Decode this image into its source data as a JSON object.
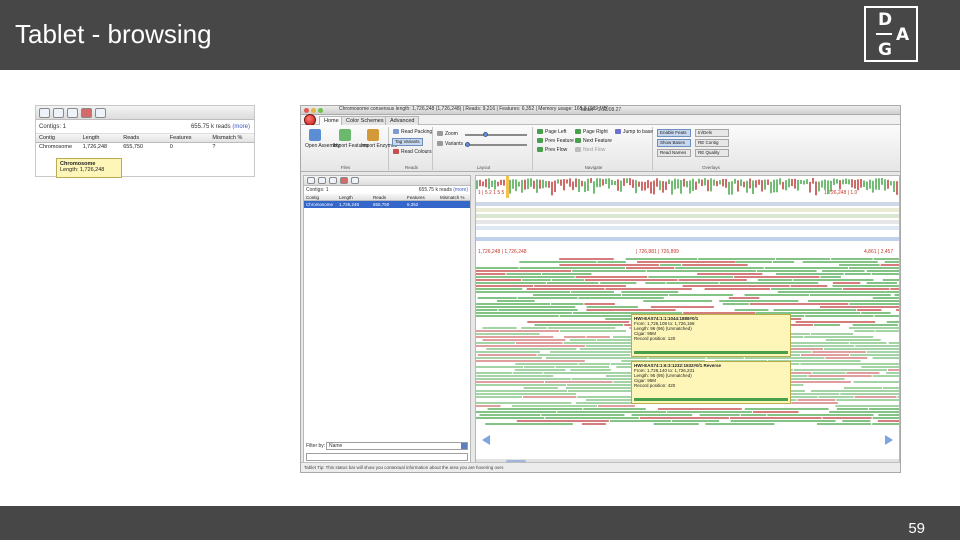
{
  "slide": {
    "title": "Tablet - browsing",
    "page_number": "59",
    "logo": {
      "letters": [
        "D",
        "A",
        "G"
      ]
    }
  },
  "contig_panel": {
    "contig_count": "Contigs: 1",
    "reads_summary": "655.75 k reads",
    "more_link": "(more)",
    "columns": [
      "Contig",
      "Length",
      "Reads",
      "Features",
      "Mismatch %"
    ],
    "row": [
      "Chromosome",
      "1,726,248",
      "655,750",
      "0",
      "?"
    ],
    "tooltip": {
      "title": "Chromosome",
      "text": "Length: 1,726,248"
    }
  },
  "app_window": {
    "title": "Tablet - 1.12.08.27",
    "status_line": "Chromosome   consensus length: 1,726,248 (1,726,248) | Reads: 9,216 | Features: 6,352 | Memory usage: 165.8 (989 MB)",
    "ribbon_tabs": [
      "Home",
      "Color Schemes",
      "Advanced"
    ],
    "ribbon": {
      "assembly_group": "Files",
      "open_assembly": "Open Assembly",
      "import_features": "Import Features",
      "import_enzymes": "Import Enzymes",
      "reads_group": "Reads",
      "read_packing": "Read Packing",
      "tag_variants": "Tag Variants",
      "read_colours": "Read Colours",
      "layout_group": "Layout",
      "zoom_label": "Zoom",
      "variants_label": "Variants",
      "navigate_group": "Navigate",
      "page_left": "Page Left",
      "page_right": "Page Right",
      "jump_to_base": "Jump to base",
      "prev_feature": "Prev Feature",
      "next_feature": "Next Feature",
      "prev_flow": "Prev Flow",
      "next_flow": "Next Flow",
      "overlays_group": "Overlays",
      "overlay_buttons": [
        "Enable Feats",
        "In/Dels",
        "Show Bases",
        "RE Contig",
        "Read Names",
        "RE Quality"
      ]
    },
    "left_pane": {
      "contig_count": "Contigs: 1",
      "reads_summary": "655.75 k reads",
      "more_link": "(more)",
      "columns": [
        "Contig",
        "Length",
        "Reads",
        "Features",
        "Mismatch %"
      ],
      "row": [
        "Chromosome",
        "1,726,248",
        "655,750",
        "6,352",
        ""
      ],
      "filter_label": "Filter by:",
      "filter_value": "Name"
    },
    "viewer": {
      "coord_left": "1 | 5 2 1 5 5",
      "coord_right": "1,726,248 | 1.0",
      "range_left": "1,726,248 | 1,726,248",
      "range_mid": "| 726,881 | 726,899",
      "range_right": "4,861 | 2,457",
      "read_tooltip_1": {
        "title": "HWI-EAS74:1:1:1044:1888#0/1",
        "lines": [
          "From: 1,726,108 to: 1,726,168",
          "Length: 96 (96) (Unmatched)",
          "Cigar: 95M",
          "Record position: 120"
        ]
      },
      "read_tooltip_2": {
        "title": "HWI-EAS74:1:6:3:1232:1532#0/1 Reverse",
        "lines": [
          "From: 1,726,140 to: 1,726,231",
          "Length: 95 (95) (Unmatched)",
          "Cigar: 95M",
          "Record position: 420"
        ]
      }
    },
    "statusbar_text": "Tablet Tip: This status bar will show you contextual information about the area you are hovering over."
  },
  "colors": {
    "bar": "#474747",
    "read_green": "#59b05d",
    "read_red": "#c75050",
    "consensus_blue": "#4a77c7",
    "tooltip_bg": "#fdf6b8"
  }
}
